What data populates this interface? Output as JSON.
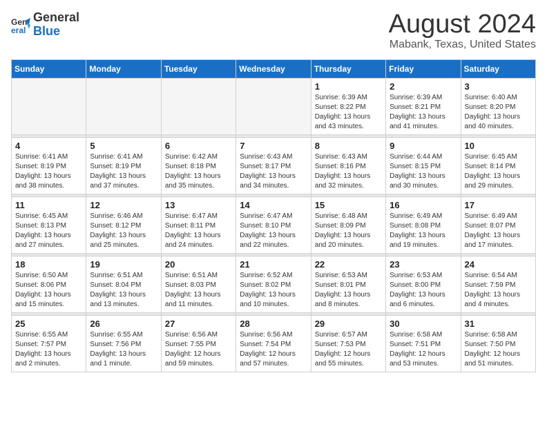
{
  "logo": {
    "general": "General",
    "blue": "Blue"
  },
  "header": {
    "month": "August 2024",
    "location": "Mabank, Texas, United States"
  },
  "weekdays": [
    "Sunday",
    "Monday",
    "Tuesday",
    "Wednesday",
    "Thursday",
    "Friday",
    "Saturday"
  ],
  "weeks": [
    [
      {
        "day": "",
        "info": ""
      },
      {
        "day": "",
        "info": ""
      },
      {
        "day": "",
        "info": ""
      },
      {
        "day": "",
        "info": ""
      },
      {
        "day": "1",
        "info": "Sunrise: 6:39 AM\nSunset: 8:22 PM\nDaylight: 13 hours\nand 43 minutes."
      },
      {
        "day": "2",
        "info": "Sunrise: 6:39 AM\nSunset: 8:21 PM\nDaylight: 13 hours\nand 41 minutes."
      },
      {
        "day": "3",
        "info": "Sunrise: 6:40 AM\nSunset: 8:20 PM\nDaylight: 13 hours\nand 40 minutes."
      }
    ],
    [
      {
        "day": "4",
        "info": "Sunrise: 6:41 AM\nSunset: 8:19 PM\nDaylight: 13 hours\nand 38 minutes."
      },
      {
        "day": "5",
        "info": "Sunrise: 6:41 AM\nSunset: 8:19 PM\nDaylight: 13 hours\nand 37 minutes."
      },
      {
        "day": "6",
        "info": "Sunrise: 6:42 AM\nSunset: 8:18 PM\nDaylight: 13 hours\nand 35 minutes."
      },
      {
        "day": "7",
        "info": "Sunrise: 6:43 AM\nSunset: 8:17 PM\nDaylight: 13 hours\nand 34 minutes."
      },
      {
        "day": "8",
        "info": "Sunrise: 6:43 AM\nSunset: 8:16 PM\nDaylight: 13 hours\nand 32 minutes."
      },
      {
        "day": "9",
        "info": "Sunrise: 6:44 AM\nSunset: 8:15 PM\nDaylight: 13 hours\nand 30 minutes."
      },
      {
        "day": "10",
        "info": "Sunrise: 6:45 AM\nSunset: 8:14 PM\nDaylight: 13 hours\nand 29 minutes."
      }
    ],
    [
      {
        "day": "11",
        "info": "Sunrise: 6:45 AM\nSunset: 8:13 PM\nDaylight: 13 hours\nand 27 minutes."
      },
      {
        "day": "12",
        "info": "Sunrise: 6:46 AM\nSunset: 8:12 PM\nDaylight: 13 hours\nand 25 minutes."
      },
      {
        "day": "13",
        "info": "Sunrise: 6:47 AM\nSunset: 8:11 PM\nDaylight: 13 hours\nand 24 minutes."
      },
      {
        "day": "14",
        "info": "Sunrise: 6:47 AM\nSunset: 8:10 PM\nDaylight: 13 hours\nand 22 minutes."
      },
      {
        "day": "15",
        "info": "Sunrise: 6:48 AM\nSunset: 8:09 PM\nDaylight: 13 hours\nand 20 minutes."
      },
      {
        "day": "16",
        "info": "Sunrise: 6:49 AM\nSunset: 8:08 PM\nDaylight: 13 hours\nand 19 minutes."
      },
      {
        "day": "17",
        "info": "Sunrise: 6:49 AM\nSunset: 8:07 PM\nDaylight: 13 hours\nand 17 minutes."
      }
    ],
    [
      {
        "day": "18",
        "info": "Sunrise: 6:50 AM\nSunset: 8:06 PM\nDaylight: 13 hours\nand 15 minutes."
      },
      {
        "day": "19",
        "info": "Sunrise: 6:51 AM\nSunset: 8:04 PM\nDaylight: 13 hours\nand 13 minutes."
      },
      {
        "day": "20",
        "info": "Sunrise: 6:51 AM\nSunset: 8:03 PM\nDaylight: 13 hours\nand 11 minutes."
      },
      {
        "day": "21",
        "info": "Sunrise: 6:52 AM\nSunset: 8:02 PM\nDaylight: 13 hours\nand 10 minutes."
      },
      {
        "day": "22",
        "info": "Sunrise: 6:53 AM\nSunset: 8:01 PM\nDaylight: 13 hours\nand 8 minutes."
      },
      {
        "day": "23",
        "info": "Sunrise: 6:53 AM\nSunset: 8:00 PM\nDaylight: 13 hours\nand 6 minutes."
      },
      {
        "day": "24",
        "info": "Sunrise: 6:54 AM\nSunset: 7:59 PM\nDaylight: 13 hours\nand 4 minutes."
      }
    ],
    [
      {
        "day": "25",
        "info": "Sunrise: 6:55 AM\nSunset: 7:57 PM\nDaylight: 13 hours\nand 2 minutes."
      },
      {
        "day": "26",
        "info": "Sunrise: 6:55 AM\nSunset: 7:56 PM\nDaylight: 13 hours\nand 1 minute."
      },
      {
        "day": "27",
        "info": "Sunrise: 6:56 AM\nSunset: 7:55 PM\nDaylight: 12 hours\nand 59 minutes."
      },
      {
        "day": "28",
        "info": "Sunrise: 6:56 AM\nSunset: 7:54 PM\nDaylight: 12 hours\nand 57 minutes."
      },
      {
        "day": "29",
        "info": "Sunrise: 6:57 AM\nSunset: 7:53 PM\nDaylight: 12 hours\nand 55 minutes."
      },
      {
        "day": "30",
        "info": "Sunrise: 6:58 AM\nSunset: 7:51 PM\nDaylight: 12 hours\nand 53 minutes."
      },
      {
        "day": "31",
        "info": "Sunrise: 6:58 AM\nSunset: 7:50 PM\nDaylight: 12 hours\nand 51 minutes."
      }
    ]
  ]
}
